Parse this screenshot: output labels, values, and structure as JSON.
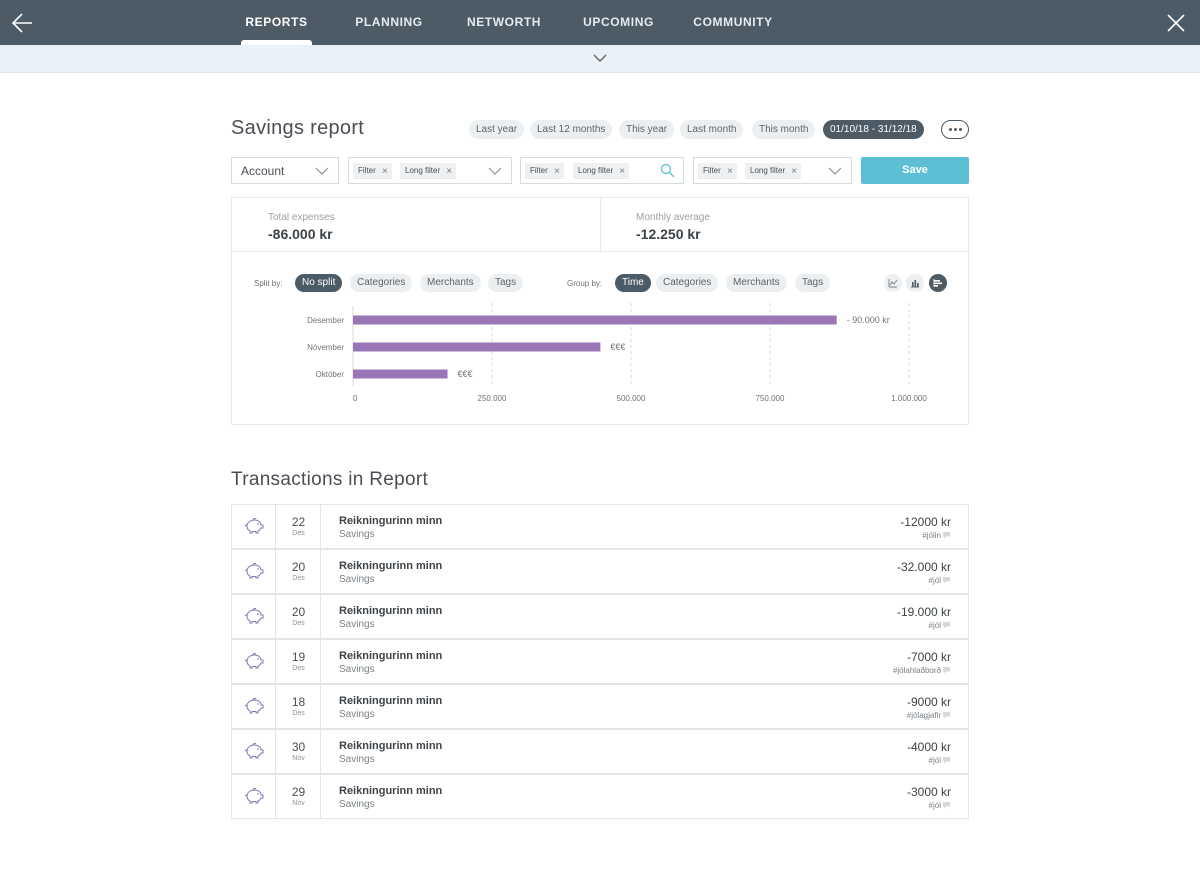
{
  "nav": {
    "tabs": [
      "REPORTS",
      "PLANNING",
      "NETWORTH",
      "UPCOMING",
      "COMMUNITY"
    ],
    "active_tab": "REPORTS"
  },
  "header": {
    "title": "Savings report",
    "date_ranges": [
      "Last year",
      "Last 12 months",
      "This year",
      "Last month",
      "This month",
      "01/10/18 - 31/12/18"
    ],
    "active_range": "01/10/18 - 31/12/18"
  },
  "filters": {
    "account_label": "Account",
    "group1": [
      "Filter",
      "Long filter"
    ],
    "group2": [
      "Filter",
      "Long filter"
    ],
    "group3": [
      "Filter",
      "Long filter"
    ],
    "save_label": "Save"
  },
  "summary": {
    "total_label": "Total expenses",
    "total_value": "-86.000 kr",
    "avg_label": "Monthly average",
    "avg_value": "-12.250 kr"
  },
  "controls": {
    "split_label": "Split by:",
    "split_options": [
      "No split",
      "Categories",
      "Merchants",
      "Tags"
    ],
    "split_active": "No split",
    "group_label": "Group by:",
    "group_options": [
      "Time",
      "Categories",
      "Merchants",
      "Tags"
    ],
    "group_active": "Time",
    "views": [
      "line-chart-icon",
      "bar-chart-icon",
      "horizontal-bar-chart-icon"
    ],
    "view_active": "horizontal-bar-chart-icon"
  },
  "chart_data": {
    "type": "bar",
    "orientation": "horizontal",
    "categories": [
      "Desember",
      "Nóvember",
      "Október"
    ],
    "values": [
      870000,
      445000,
      170000
    ],
    "data_labels": [
      "- 90.000 kr",
      "€€€",
      "€€€"
    ],
    "xticks": [
      "0",
      "250.000",
      "500.000",
      "750.000",
      "1.000.000"
    ],
    "xtick_values": [
      0,
      250000,
      500000,
      750000,
      1000000
    ],
    "xlim": [
      0,
      1000000
    ],
    "color": "#9a76b7",
    "grid": "vertical-dashed"
  },
  "transactions": {
    "title": "Transactions in Report",
    "items": [
      {
        "day": "22",
        "month": "Des",
        "name": "Reikningurinn minn",
        "category": "Savings",
        "amount": "-12000 kr",
        "tag": "#jólin"
      },
      {
        "day": "20",
        "month": "Des",
        "name": "Reikningurinn minn",
        "category": "Savings",
        "amount": "-32.000 kr",
        "tag": "#jól"
      },
      {
        "day": "20",
        "month": "Des",
        "name": "Reikningurinn minn",
        "category": "Savings",
        "amount": "-19.000 kr",
        "tag": "#jól"
      },
      {
        "day": "19",
        "month": "Des",
        "name": "Reikningurinn minn",
        "category": "Savings",
        "amount": "-7000 kr",
        "tag": "#jólahlaðborð"
      },
      {
        "day": "18",
        "month": "Des",
        "name": "Reikningurinn minn",
        "category": "Savings",
        "amount": "-9000 kr",
        "tag": "#jólagjafir"
      },
      {
        "day": "30",
        "month": "Nóv",
        "name": "Reikningurinn minn",
        "category": "Savings",
        "amount": "-4000 kr",
        "tag": "#jól"
      },
      {
        "day": "29",
        "month": "Nóv",
        "name": "Reikningurinn minn",
        "category": "Savings",
        "amount": "-3000 kr",
        "tag": "#jól"
      }
    ]
  },
  "colors": {
    "nav_bg": "#4d5b66",
    "accent": "#5cbfd4",
    "bar": "#9a76b7",
    "icon": "#8a73b5"
  }
}
